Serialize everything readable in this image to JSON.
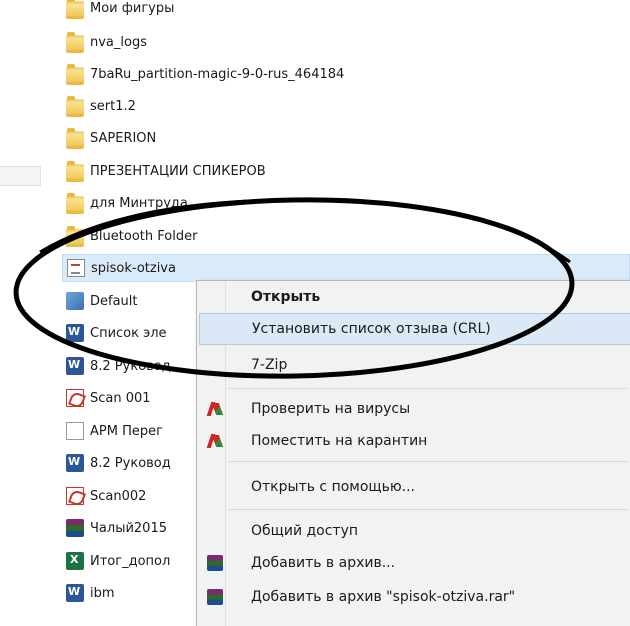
{
  "files": [
    {
      "name": "Мои фигуры",
      "icon": "folder-icon",
      "type": "folder"
    },
    {
      "name": "nva_logs",
      "icon": "folder-icon",
      "type": "folder"
    },
    {
      "name": "7baRu_partition-magic-9-0-rus_464184",
      "icon": "folder-icon",
      "type": "folder"
    },
    {
      "name": "sert1.2",
      "icon": "folder-icon",
      "type": "folder"
    },
    {
      "name": "SAPERION",
      "icon": "folder-icon",
      "type": "folder"
    },
    {
      "name": "ПРЕЗЕНТАЦИИ СПИКЕРОВ",
      "icon": "folder-icon",
      "type": "folder"
    },
    {
      "name": "для Минтруда",
      "icon": "folder-icon",
      "type": "folder"
    },
    {
      "name": "Bluetooth Folder",
      "icon": "folder-icon",
      "type": "folder"
    },
    {
      "name": "spisok-otziva",
      "icon": "certificate-list-icon",
      "type": "cert"
    },
    {
      "name": "Default",
      "icon": "shortcut-icon",
      "type": "lnk"
    },
    {
      "name": "Список эле",
      "icon": "word-doc-icon",
      "type": "word"
    },
    {
      "name": "8.2 Руковод",
      "icon": "word-doc-icon",
      "type": "word"
    },
    {
      "name": "Scan 001",
      "icon": "pdf-icon",
      "type": "pdf"
    },
    {
      "name": "АРМ Перег",
      "icon": "blank-file-icon",
      "type": "blank"
    },
    {
      "name": "8.2 Руковод",
      "icon": "word-doc-icon",
      "type": "word"
    },
    {
      "name": "Scan002",
      "icon": "pdf-icon",
      "type": "pdf"
    },
    {
      "name": "Чалый2015",
      "icon": "winrar-archive-icon",
      "type": "rar"
    },
    {
      "name": "Итог_допол",
      "icon": "excel-doc-icon",
      "type": "excel"
    },
    {
      "name": "ibm",
      "icon": "word-doc-icon",
      "type": "word"
    }
  ],
  "selected_file": "spisok-otziva",
  "context_menu": {
    "items": [
      {
        "label": "Открыть",
        "bold": true
      },
      {
        "label": "Установить список отзыва (CRL)",
        "hover": true
      },
      {
        "label": "7-Zip"
      },
      {
        "label": "Проверить на вирусы",
        "icon": "kaspersky-icon"
      },
      {
        "label": "Поместить на карантин",
        "icon": "kaspersky-icon"
      },
      {
        "label": "Открыть с помощью..."
      },
      {
        "label": "Общий доступ"
      },
      {
        "label": "Добавить в архив...",
        "icon": "winrar-icon"
      },
      {
        "label": "Добавить в архив \"spisok-otziva.rar\"",
        "icon": "winrar-icon"
      }
    ]
  },
  "colors": {
    "highlight": "#d9ebf9",
    "menu_bg": "#f2f2f2",
    "menu_hover": "#dbe9f7",
    "annotation_oval": "#000000"
  }
}
